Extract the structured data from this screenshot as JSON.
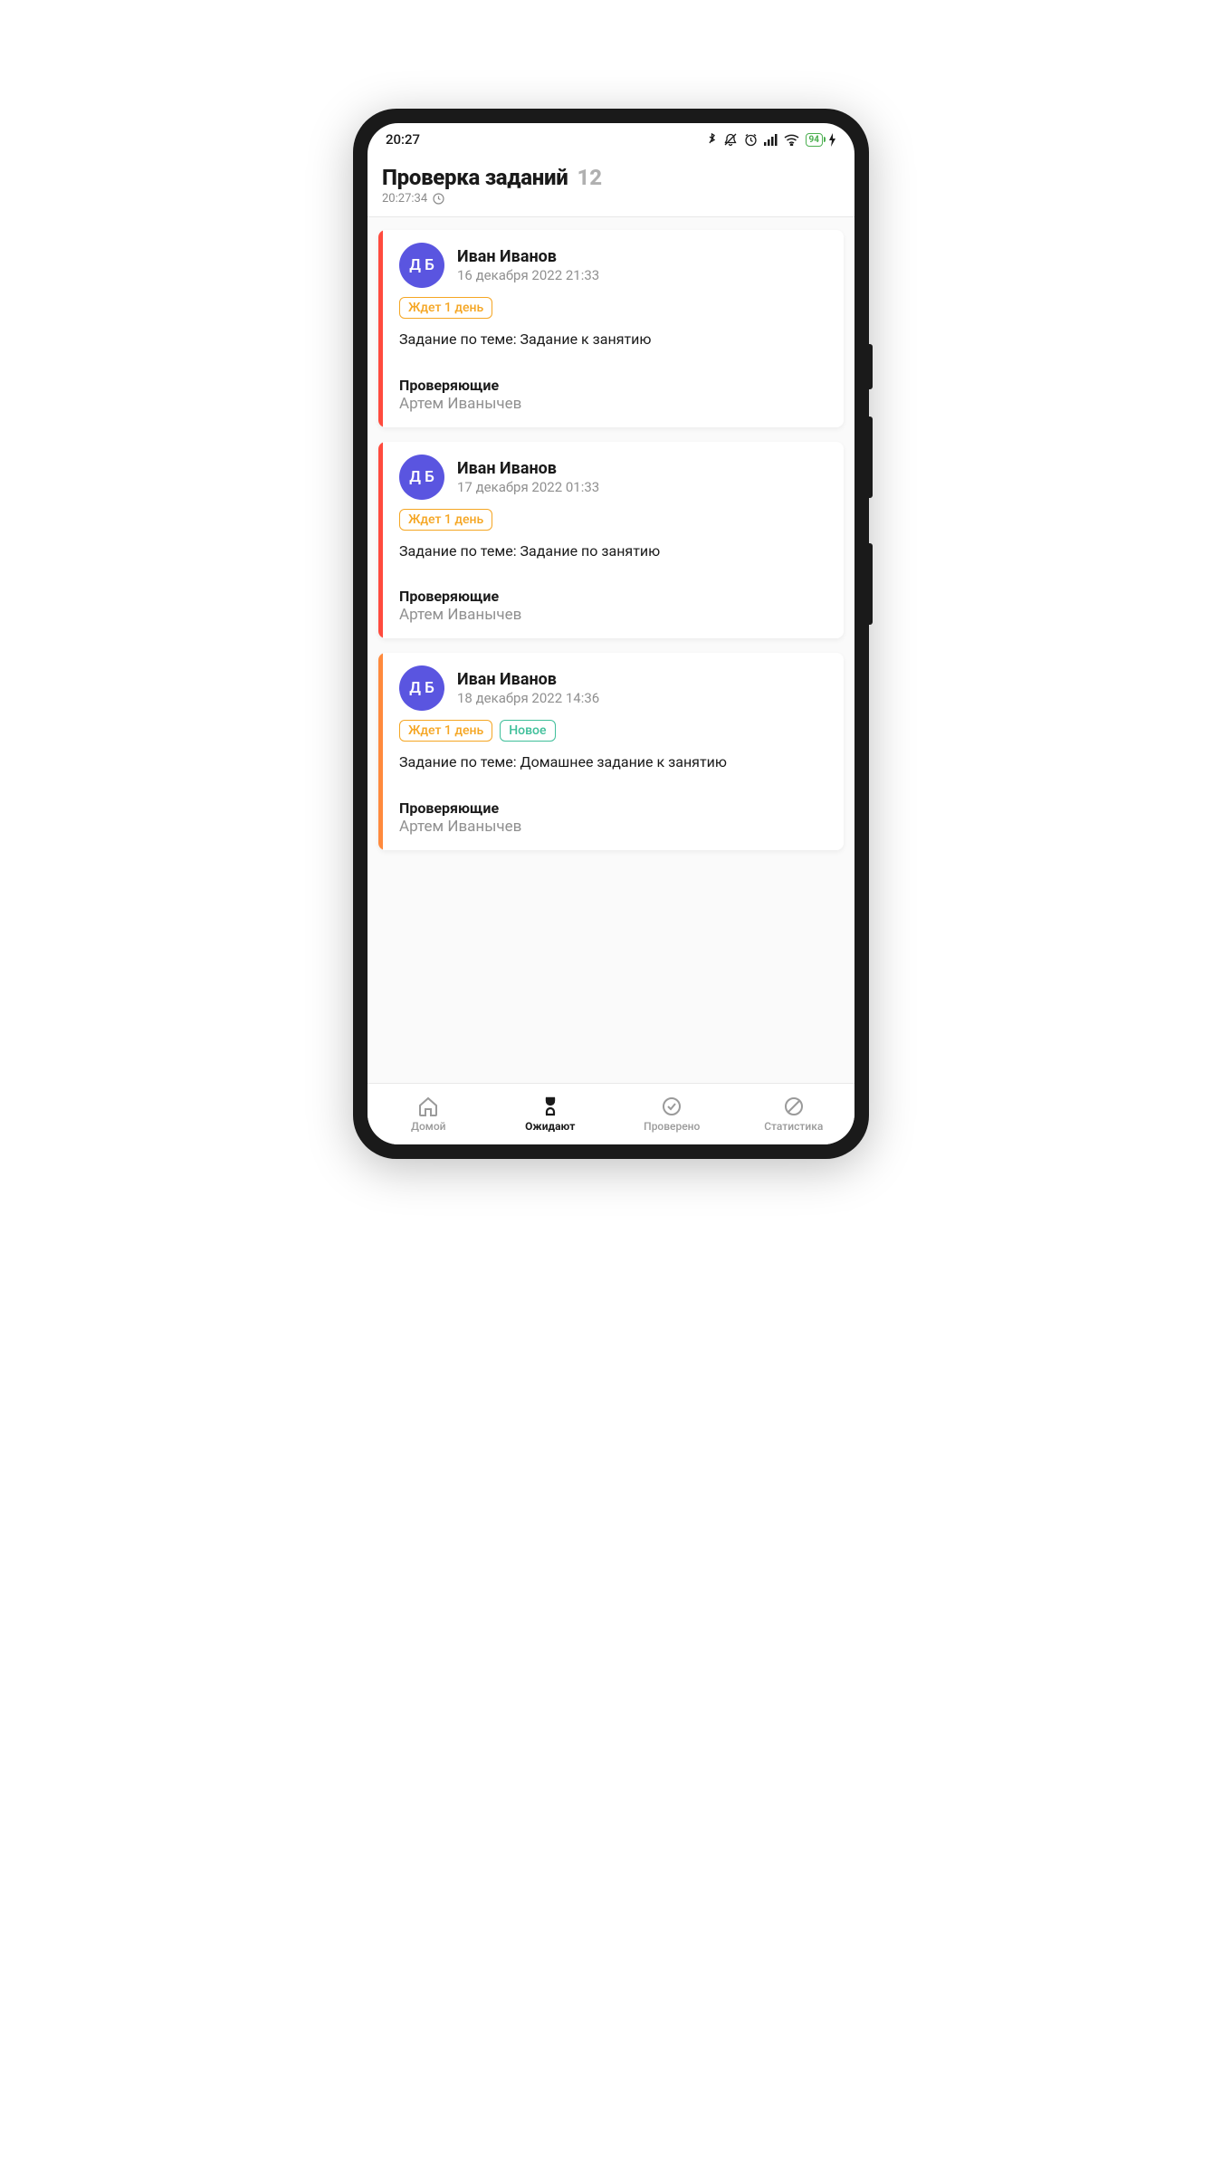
{
  "status_bar": {
    "time": "20:27",
    "battery": "94"
  },
  "header": {
    "title": "Проверка заданий",
    "count": "12",
    "time": "20:27:34"
  },
  "cards": [
    {
      "stripe_color": "#ff4b3e",
      "avatar_initials": "Д Б",
      "student_name": "Иван Иванов",
      "submit_date": "16 декабря 2022 21:33",
      "wait_badge": "Ждет 1 день",
      "new_badge": null,
      "topic": "Задание по теме: Задание к занятию",
      "reviewers_label": "Проверяющие",
      "reviewers_name": "Артем Иванычев"
    },
    {
      "stripe_color": "#ff4b3e",
      "avatar_initials": "Д Б",
      "student_name": "Иван Иванов",
      "submit_date": "17 декабря 2022 01:33",
      "wait_badge": "Ждет 1 день",
      "new_badge": null,
      "topic": "Задание по теме: Задание по занятию",
      "reviewers_label": "Проверяющие",
      "reviewers_name": "Артем Иванычев"
    },
    {
      "stripe_color": "#ff8a3d",
      "avatar_initials": "Д Б",
      "student_name": "Иван Иванов",
      "submit_date": "18 декабря 2022 14:36",
      "wait_badge": "Ждет 1 день",
      "new_badge": "Новое",
      "topic": "Задание по теме: Домашнее задание к занятию",
      "reviewers_label": "Проверяющие",
      "reviewers_name": "Артем Иванычев"
    }
  ],
  "nav": {
    "home": "Домой",
    "pending": "Ожидают",
    "checked": "Проверено",
    "stats": "Статистика"
  }
}
